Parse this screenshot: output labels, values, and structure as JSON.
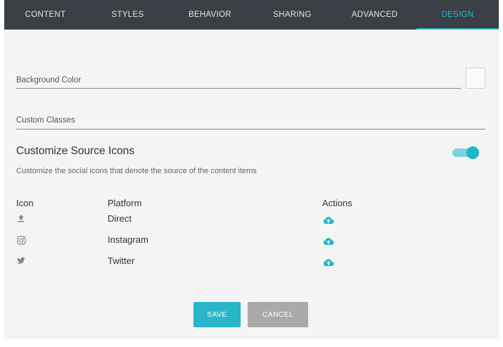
{
  "tabs": [
    {
      "label": "CONTENT"
    },
    {
      "label": "STYLES"
    },
    {
      "label": "BEHAVIOR"
    },
    {
      "label": "SHARING"
    },
    {
      "label": "ADVANCED"
    },
    {
      "label": "DESIGN",
      "active": true
    }
  ],
  "fields": {
    "background_color_label": "Background Color",
    "custom_classes_label": "Custom Classes"
  },
  "source_icons": {
    "title": "Customize Source Icons",
    "description": "Customize the social icons that denote the source of the content items",
    "toggle_on": true,
    "columns": {
      "icon": "Icon",
      "platform": "Platform",
      "actions": "Actions"
    },
    "rows": [
      {
        "icon": "upload-icon",
        "platform": "Direct",
        "action_icon": "cloud-upload-icon"
      },
      {
        "icon": "instagram-icon",
        "platform": "Instagram",
        "action_icon": "cloud-upload-icon"
      },
      {
        "icon": "twitter-icon",
        "platform": "Twitter",
        "action_icon": "cloud-upload-icon"
      }
    ]
  },
  "buttons": {
    "save": "SAVE",
    "cancel": "CANCEL"
  },
  "colors": {
    "tab_bar": "#3b3e45",
    "accent": "#2ab6c9",
    "cancel_button": "#a9a9aa",
    "panel_background": "#f4f4f4"
  }
}
